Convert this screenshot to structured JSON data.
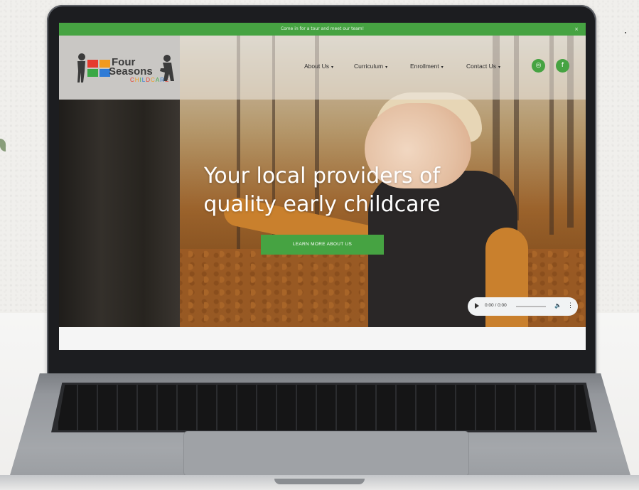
{
  "announcement": {
    "text": "Come in for a tour and meet our team!",
    "close": "×"
  },
  "brand": {
    "line1": "Four",
    "line2": "Seasons",
    "line3": "CHILDCARE",
    "colors": {
      "red": "#e63b2e",
      "orange": "#f29a1f",
      "green": "#3aa845",
      "blue": "#2e7bd6"
    }
  },
  "nav": [
    {
      "label": "About Us"
    },
    {
      "label": "Curriculum"
    },
    {
      "label": "Enrollment"
    },
    {
      "label": "Contact Us"
    }
  ],
  "social": [
    {
      "icon": "instagram-icon",
      "glyph": "◎"
    },
    {
      "icon": "facebook-icon",
      "glyph": "f"
    }
  ],
  "hero": {
    "headline_line1": "Your local providers of",
    "headline_line2": "quality early childcare",
    "cta": "LEARN MORE ABOUT US"
  },
  "audio": {
    "time": "0:00 / 0:00",
    "volume_icon": "volume-icon",
    "more_icon": "more-vertical-icon"
  },
  "theme": {
    "accent": "#46a342"
  }
}
